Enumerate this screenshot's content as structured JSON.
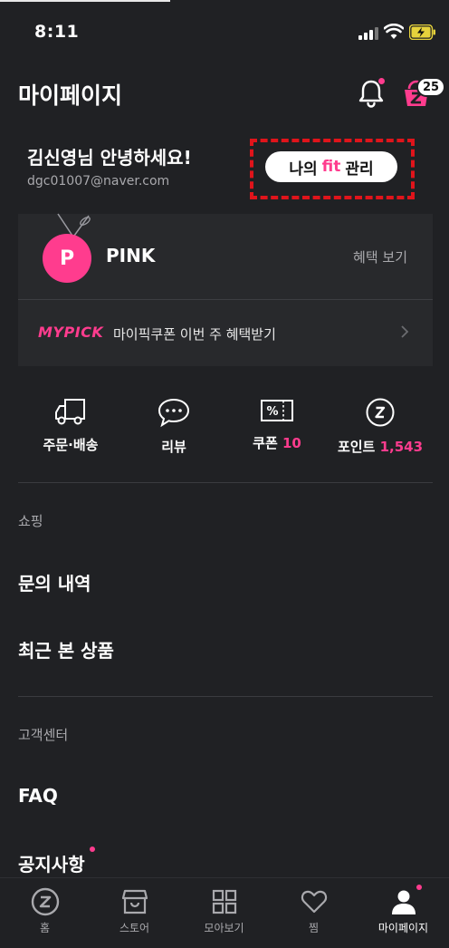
{
  "status_bar": {
    "time": "8:11"
  },
  "header": {
    "title": "마이페이지",
    "cart_count": "25"
  },
  "profile": {
    "greeting": "김신영님 안녕하세요!",
    "email": "dgc01007@naver.com",
    "fit_button": {
      "prefix": "나의",
      "fit": "fit",
      "suffix": "관리"
    }
  },
  "membership": {
    "grade_initial": "P",
    "grade_name": "PINK",
    "benefit_link": "혜택 보기",
    "mypick_logo": "MYPICK",
    "mypick_text": "마이픽쿠폰 이번 주 혜택받기"
  },
  "quick_menu": [
    {
      "label": "주문·배송",
      "count": ""
    },
    {
      "label": "리뷰",
      "count": ""
    },
    {
      "label": "쿠폰",
      "count": "10"
    },
    {
      "label": "포인트",
      "count": "1,543"
    }
  ],
  "sections": {
    "shopping": {
      "title": "쇼핑",
      "items": [
        "문의 내역",
        "최근 본 상품"
      ]
    },
    "customer_center": {
      "title": "고객센터",
      "items": [
        "FAQ",
        "공지사항"
      ]
    }
  },
  "bottom_nav": [
    {
      "label": "홈"
    },
    {
      "label": "스토어"
    },
    {
      "label": "모아보기"
    },
    {
      "label": "찜"
    },
    {
      "label": "마이페이지"
    }
  ],
  "colors": {
    "accent": "#ff3c8e",
    "background": "#202124",
    "highlight_box": "#e0141b"
  }
}
